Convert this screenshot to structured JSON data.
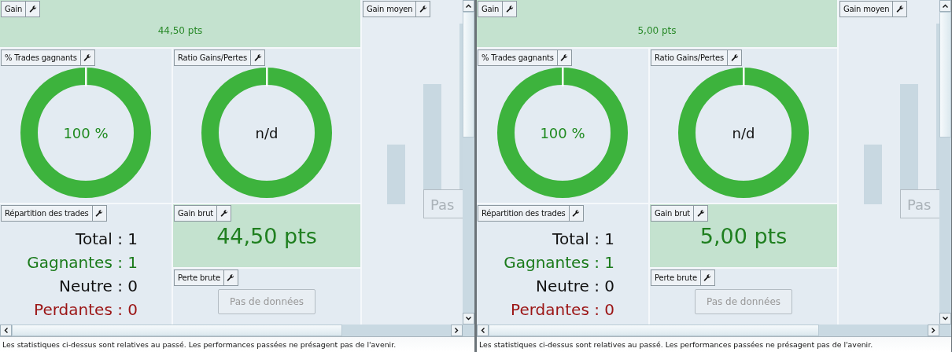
{
  "panes": [
    {
      "gain": {
        "title": "Gain",
        "value": "44,50 pts"
      },
      "win_rate": {
        "title": "% Trades gagnants",
        "value": "100 %"
      },
      "ratio": {
        "title": "Ratio Gains/Pertes",
        "value": "n/d"
      },
      "distribution": {
        "title": "Répartition des trades",
        "lines": [
          {
            "kind": "total",
            "text": "Total : 1"
          },
          {
            "kind": "win",
            "text": "Gagnantes : 1"
          },
          {
            "kind": "neutral",
            "text": "Neutre : 0"
          },
          {
            "kind": "loss",
            "text": "Perdantes : 0"
          }
        ]
      },
      "gross_gain": {
        "title": "Gain brut",
        "value": "44,50 pts"
      },
      "gross_loss": {
        "title": "Perte brute",
        "empty": "Pas de données"
      },
      "average_gain": {
        "title": "Gain moyen",
        "empty": "Pas"
      },
      "footer": "Les statistiques ci-dessus sont relatives au passé. Les performances passées ne présagent pas de l'avenir."
    },
    {
      "gain": {
        "title": "Gain",
        "value": "5,00 pts"
      },
      "win_rate": {
        "title": "% Trades gagnants",
        "value": "100 %"
      },
      "ratio": {
        "title": "Ratio Gains/Pertes",
        "value": "n/d"
      },
      "distribution": {
        "title": "Répartition des trades",
        "lines": [
          {
            "kind": "total",
            "text": "Total : 1"
          },
          {
            "kind": "win",
            "text": "Gagnantes : 1"
          },
          {
            "kind": "neutral",
            "text": "Neutre : 0"
          },
          {
            "kind": "loss",
            "text": "Perdantes : 0"
          }
        ]
      },
      "gross_gain": {
        "title": "Gain brut",
        "value": "5,00 pts"
      },
      "gross_loss": {
        "title": "Perte brute",
        "empty": "Pas de données"
      },
      "average_gain": {
        "title": "Gain moyen",
        "empty": "Pas"
      },
      "footer": "Les statistiques ci-dessus sont relatives au passé. Les performances passées ne présagent pas de l'avenir."
    }
  ]
}
